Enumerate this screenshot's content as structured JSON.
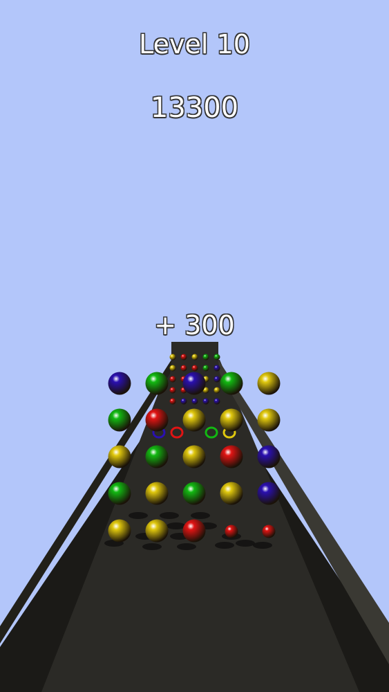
{
  "hud": {
    "level_label": "Level 10",
    "score": "13300",
    "bonus_popup": "+ 300"
  },
  "colors": {
    "sky": "#b3c6fa",
    "track": "#2b2a26",
    "track_side": "#1b1a17",
    "red": "#e01414",
    "green": "#12b812",
    "yellow": "#e0c80e",
    "blue": "#2a10b0"
  },
  "ball_grid": {
    "front_rows": [
      [
        "blue",
        "green",
        "blue",
        "green",
        "yellow"
      ],
      [
        "green",
        "red",
        "yellow",
        "yellow",
        "yellow"
      ],
      [
        "yellow",
        "green",
        "yellow",
        "red",
        "blue"
      ],
      [
        "green",
        "yellow",
        "green",
        "yellow",
        "blue"
      ],
      [
        "yellow",
        "yellow",
        "red",
        "red",
        "red"
      ]
    ],
    "rings": [
      "blue",
      "red",
      "green",
      "yellow"
    ],
    "far_rows": [
      [
        "yellow",
        "red",
        "yellow",
        "green",
        "green"
      ],
      [
        "yellow",
        "red",
        "red",
        "green",
        "blue"
      ],
      [
        "red",
        "red",
        "blue",
        "yellow",
        "blue"
      ],
      [
        "red",
        "red",
        "yellow",
        "yellow",
        "yellow"
      ],
      [
        "red",
        "blue",
        "blue",
        "blue",
        "blue"
      ]
    ]
  }
}
